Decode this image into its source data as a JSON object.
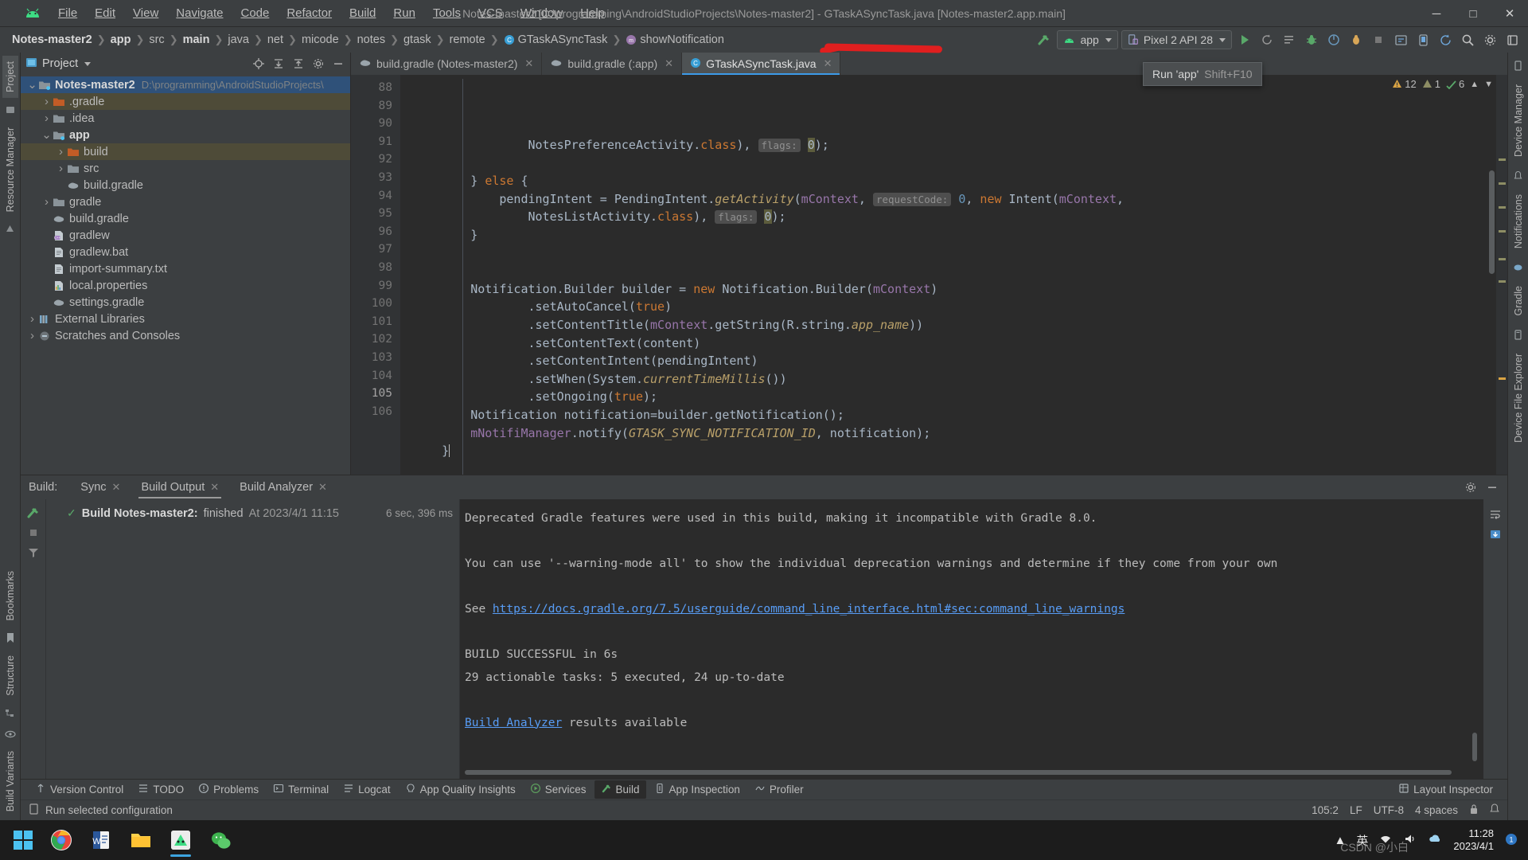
{
  "window": {
    "title": "Notes-master2 [D:\\programming\\AndroidStudioProjects\\Notes-master2] - GTaskASyncTask.java [Notes-master2.app.main]",
    "minimize": "─",
    "maximize": "□",
    "close": "✕"
  },
  "menubar": {
    "logo": "android-logo-icon",
    "items": [
      {
        "label": "File"
      },
      {
        "label": "Edit"
      },
      {
        "label": "View"
      },
      {
        "label": "Navigate"
      },
      {
        "label": "Code"
      },
      {
        "label": "Refactor"
      },
      {
        "label": "Build"
      },
      {
        "label": "Run"
      },
      {
        "label": "Tools"
      },
      {
        "label": "VCS"
      },
      {
        "label": "Window"
      },
      {
        "label": "Help"
      }
    ]
  },
  "breadcrumbs": [
    {
      "label": "Notes-master2",
      "bold": true
    },
    {
      "label": "app",
      "bold": true
    },
    {
      "label": "src",
      "bold": false
    },
    {
      "label": "main",
      "bold": true
    },
    {
      "label": "java",
      "bold": false
    },
    {
      "label": "net",
      "bold": false
    },
    {
      "label": "micode",
      "bold": false
    },
    {
      "label": "notes",
      "bold": false
    },
    {
      "label": "gtask",
      "bold": false
    },
    {
      "label": "remote",
      "bold": false
    },
    {
      "label": "GTaskASyncTask",
      "bold": false,
      "icon": "class-icon"
    },
    {
      "label": "showNotification",
      "bold": false,
      "icon": "method-icon"
    }
  ],
  "toolbar": {
    "build_label": "build-hammer-icon",
    "module_combo": "app",
    "device_combo": "Pixel 2 API 28",
    "run_button": "run-icon",
    "rerun_button": "rerun-icon",
    "coverage_button": "coverage-icon",
    "debug_button": "debug-icon",
    "profile_button": "profile-icon",
    "attach_button": "attach-debugger-icon",
    "devicemgr_button": "device-manager-icon",
    "stop_button": "stop-icon",
    "sdk_button": "sdk-manager-icon",
    "avd_button": "avd-manager-icon",
    "sync_button": "gradle-sync-icon",
    "search_button": "search-icon",
    "settings_button": "gear-icon",
    "more_button": "more-icon",
    "tooltip": {
      "text": "Run 'app'",
      "shortcut": "Shift+F10"
    }
  },
  "left_rail": {
    "top": [
      "Project",
      "Resource Manager"
    ],
    "bottom": [
      "Bookmarks",
      "Structure",
      "Build Variants"
    ]
  },
  "right_rail": {
    "items": [
      "Device Manager",
      "Notifications",
      "Gradle",
      "Device File Explorer"
    ]
  },
  "project_panel": {
    "title": "Project",
    "actions": [
      "locate-icon",
      "expand-all-icon",
      "collapse-all-icon",
      "gear-icon",
      "hide-icon"
    ],
    "tree": [
      {
        "depth": 0,
        "arrow": "down",
        "icon": "module-folder-icon",
        "label": "Notes-master2",
        "bold": true,
        "path": "D:\\programming\\AndroidStudioProjects\\",
        "state": "selected"
      },
      {
        "depth": 1,
        "arrow": "right",
        "icon": "folder-excluded-icon",
        "label": ".gradle",
        "bold": false,
        "state": "highlight"
      },
      {
        "depth": 1,
        "arrow": "right",
        "icon": "folder-icon",
        "label": ".idea",
        "bold": false,
        "state": "none"
      },
      {
        "depth": 1,
        "arrow": "down",
        "icon": "module-folder-icon",
        "label": "app",
        "bold": true,
        "state": "none"
      },
      {
        "depth": 2,
        "arrow": "right",
        "icon": "folder-excluded-icon",
        "label": "build",
        "bold": false,
        "state": "highlight"
      },
      {
        "depth": 2,
        "arrow": "right",
        "icon": "folder-icon",
        "label": "src",
        "bold": false,
        "state": "none"
      },
      {
        "depth": 2,
        "arrow": "none",
        "icon": "gradle-file-icon",
        "label": "build.gradle",
        "bold": false,
        "state": "none"
      },
      {
        "depth": 1,
        "arrow": "right",
        "icon": "folder-icon",
        "label": "gradle",
        "bold": false,
        "state": "none"
      },
      {
        "depth": 1,
        "arrow": "none",
        "icon": "gradle-file-icon",
        "label": "build.gradle",
        "bold": false,
        "state": "none"
      },
      {
        "depth": 1,
        "arrow": "none",
        "icon": "script-file-icon",
        "label": "gradlew",
        "bold": false,
        "state": "none"
      },
      {
        "depth": 1,
        "arrow": "none",
        "icon": "text-file-icon",
        "label": "gradlew.bat",
        "bold": false,
        "state": "none"
      },
      {
        "depth": 1,
        "arrow": "none",
        "icon": "text-file-icon",
        "label": "import-summary.txt",
        "bold": false,
        "state": "none"
      },
      {
        "depth": 1,
        "arrow": "none",
        "icon": "properties-file-icon",
        "label": "local.properties",
        "bold": false,
        "state": "none"
      },
      {
        "depth": 1,
        "arrow": "none",
        "icon": "gradle-file-icon",
        "label": "settings.gradle",
        "bold": false,
        "state": "none"
      },
      {
        "depth": 0,
        "arrow": "right",
        "icon": "libraries-icon",
        "label": "External Libraries",
        "bold": false,
        "state": "none"
      },
      {
        "depth": 0,
        "arrow": "right",
        "icon": "scratches-icon",
        "label": "Scratches and Consoles",
        "bold": false,
        "state": "none"
      }
    ]
  },
  "editor": {
    "tabs": [
      {
        "label": "build.gradle (Notes-master2)",
        "icon": "gradle-file-icon",
        "active": false
      },
      {
        "label": "build.gradle (:app)",
        "icon": "gradle-file-icon",
        "active": false
      },
      {
        "label": "GTaskASyncTask.java",
        "icon": "class-icon",
        "active": true
      }
    ],
    "inspections": {
      "warnings": "12",
      "weak_warnings": "1",
      "typos": "6"
    },
    "first_line": 88,
    "lines": [
      {
        "n": 88,
        "tokens": [
          {
            "t": "                ",
            "c": "plain"
          },
          {
            "t": "NotesPreferenceActivity.",
            "c": "plain"
          },
          {
            "t": "class",
            "c": "kw"
          },
          {
            "t": "), ",
            "c": "plain"
          },
          {
            "t": "flags:",
            "c": "hint"
          },
          {
            "t": " ",
            "c": "plain"
          },
          {
            "t": "0",
            "c": "numhl"
          },
          {
            "t": ");",
            "c": "plain"
          }
        ]
      },
      {
        "n": 89,
        "tokens": []
      },
      {
        "n": 90,
        "fold": "minus",
        "tokens": [
          {
            "t": "        } ",
            "c": "plain"
          },
          {
            "t": "else",
            "c": "kw"
          },
          {
            "t": " {",
            "c": "plain"
          }
        ]
      },
      {
        "n": 91,
        "tokens": [
          {
            "t": "            pendingIntent = PendingIntent.",
            "c": "plain"
          },
          {
            "t": "getActivity",
            "c": "stat"
          },
          {
            "t": "(",
            "c": "plain"
          },
          {
            "t": "mContext",
            "c": "fld"
          },
          {
            "t": ", ",
            "c": "plain"
          },
          {
            "t": "requestCode:",
            "c": "hint"
          },
          {
            "t": " ",
            "c": "plain"
          },
          {
            "t": "0",
            "c": "num"
          },
          {
            "t": ", ",
            "c": "plain"
          },
          {
            "t": "new",
            "c": "kw"
          },
          {
            "t": " Intent(",
            "c": "plain"
          },
          {
            "t": "mContext",
            "c": "fld"
          },
          {
            "t": ",",
            "c": "plain"
          }
        ]
      },
      {
        "n": 92,
        "tokens": [
          {
            "t": "                NotesListActivity.",
            "c": "plain"
          },
          {
            "t": "class",
            "c": "kw"
          },
          {
            "t": "), ",
            "c": "plain"
          },
          {
            "t": "flags:",
            "c": "hint"
          },
          {
            "t": " ",
            "c": "plain"
          },
          {
            "t": "0",
            "c": "numhl"
          },
          {
            "t": ");",
            "c": "plain"
          }
        ]
      },
      {
        "n": 93,
        "fold": "minus",
        "tokens": [
          {
            "t": "        }",
            "c": "plain"
          }
        ]
      },
      {
        "n": 94,
        "tokens": []
      },
      {
        "n": 95,
        "tokens": []
      },
      {
        "n": 96,
        "tokens": [
          {
            "t": "        Notification.Builder builder = ",
            "c": "plain"
          },
          {
            "t": "new",
            "c": "kw"
          },
          {
            "t": " Notification.Builder(",
            "c": "plain"
          },
          {
            "t": "mContext",
            "c": "fld"
          },
          {
            "t": ")",
            "c": "plain"
          }
        ]
      },
      {
        "n": 97,
        "tokens": [
          {
            "t": "                .setAutoCancel(",
            "c": "plain"
          },
          {
            "t": "true",
            "c": "kw"
          },
          {
            "t": ")",
            "c": "plain"
          }
        ]
      },
      {
        "n": 98,
        "tokens": [
          {
            "t": "                .setContentTitle(",
            "c": "plain"
          },
          {
            "t": "mContext",
            "c": "fld"
          },
          {
            "t": ".getString(R.string.",
            "c": "plain"
          },
          {
            "t": "app_name",
            "c": "stat"
          },
          {
            "t": "))",
            "c": "plain"
          }
        ]
      },
      {
        "n": 99,
        "tokens": [
          {
            "t": "                .setContentText(content)",
            "c": "plain"
          }
        ]
      },
      {
        "n": 100,
        "tokens": [
          {
            "t": "                .setContentIntent(pendingIntent)",
            "c": "plain"
          }
        ]
      },
      {
        "n": 101,
        "tokens": [
          {
            "t": "                .setWhen(System.",
            "c": "plain"
          },
          {
            "t": "currentTimeMillis",
            "c": "stat"
          },
          {
            "t": "())",
            "c": "plain"
          }
        ]
      },
      {
        "n": 102,
        "tokens": [
          {
            "t": "                .setOngoing(",
            "c": "plain"
          },
          {
            "t": "true",
            "c": "kw"
          },
          {
            "t": ");",
            "c": "plain"
          }
        ]
      },
      {
        "n": 103,
        "tokens": [
          {
            "t": "        Notification notification=builder.getNotification();",
            "c": "plain"
          }
        ]
      },
      {
        "n": 104,
        "tokens": [
          {
            "t": "        ",
            "c": "plain"
          },
          {
            "t": "mNotifiManager",
            "c": "fld"
          },
          {
            "t": ".notify(",
            "c": "plain"
          },
          {
            "t": "GTASK_SYNC_NOTIFICATION_ID",
            "c": "stat"
          },
          {
            "t": ", notification);",
            "c": "plain"
          }
        ]
      },
      {
        "n": 105,
        "fold": "minus",
        "caret": true,
        "tokens": [
          {
            "t": "    }",
            "c": "plain"
          }
        ]
      },
      {
        "n": 106,
        "tokens": []
      }
    ]
  },
  "build_panel": {
    "label": "Build:",
    "tabs": [
      {
        "label": "Sync",
        "closable": true,
        "active": false
      },
      {
        "label": "Build Output",
        "closable": true,
        "active": true
      },
      {
        "label": "Build Analyzer",
        "closable": true,
        "active": false
      }
    ],
    "actions": [
      "gear-icon",
      "hide-icon"
    ],
    "tool_buttons": [
      "restart-icon",
      "stop-icon",
      "filter-icon"
    ],
    "tree": {
      "status_icon": "check-icon",
      "title": "Build Notes-master2:",
      "status": "finished",
      "timestamp": "At 2023/4/1 11:15",
      "duration": "6 sec, 396 ms"
    },
    "console": [
      {
        "text": "Deprecated Gradle features were used in this build, making it incompatible with Gradle 8.0.",
        "link": false
      },
      {
        "text": "",
        "link": false
      },
      {
        "text": "You can use '--warning-mode all' to show the individual deprecation warnings and determine if they come from your own",
        "link": false
      },
      {
        "text": "",
        "link": false
      },
      {
        "text": "See ",
        "link": false,
        "linkText": "https://docs.gradle.org/7.5/userguide/command_line_interface.html#sec:command_line_warnings"
      },
      {
        "text": "",
        "link": false
      },
      {
        "text": "BUILD SUCCESSFUL in 6s",
        "link": false
      },
      {
        "text": "29 actionable tasks: 5 executed, 24 up-to-date",
        "link": false
      },
      {
        "text": "",
        "link": false
      },
      {
        "text": "",
        "link": false,
        "linkText2": "Build Analyzer",
        "after": " results available"
      }
    ],
    "console_right_buttons": [
      "wrap-icon",
      "scroll-to-end-icon"
    ]
  },
  "toolwindow_bar": {
    "items": [
      {
        "label": "Version Control",
        "icon": "vcs-icon",
        "active": false
      },
      {
        "label": "TODO",
        "icon": "todo-icon",
        "active": false
      },
      {
        "label": "Problems",
        "icon": "problems-icon",
        "active": false
      },
      {
        "label": "Terminal",
        "icon": "terminal-icon",
        "active": false
      },
      {
        "label": "Logcat",
        "icon": "logcat-icon",
        "active": false
      },
      {
        "label": "App Quality Insights",
        "icon": "insights-icon",
        "active": false
      },
      {
        "label": "Services",
        "icon": "services-icon",
        "active": false
      },
      {
        "label": "Build",
        "icon": "build-icon",
        "active": true
      },
      {
        "label": "App Inspection",
        "icon": "inspection-icon",
        "active": false
      },
      {
        "label": "Profiler",
        "icon": "profiler-icon",
        "active": false
      }
    ],
    "right": [
      {
        "label": "Layout Inspector",
        "icon": "layout-inspector-icon"
      }
    ]
  },
  "statusbar": {
    "message": "Run selected configuration",
    "icon": "run-config-icon",
    "caret_position": "105:2",
    "line_separator": "LF",
    "encoding": "UTF-8",
    "indent": "4 spaces",
    "lock_icon": "lock-icon",
    "notification_icon": "notifications-icon"
  },
  "taskbar": {
    "start": "windows-start-icon",
    "apps": [
      {
        "name": "chrome-icon",
        "active": false
      },
      {
        "name": "word-icon",
        "active": false
      },
      {
        "name": "explorer-icon",
        "active": false
      },
      {
        "name": "android-studio-icon",
        "active": true
      },
      {
        "name": "wechat-icon",
        "active": false
      }
    ],
    "tray": {
      "chevron": "⌃",
      "ime": "英",
      "wifi": "wifi-icon",
      "volume": "volume-icon",
      "cloud": "cloud-icon"
    },
    "clock": {
      "time": "11:28",
      "date": "2023/4/1"
    },
    "watermark": "CSDN @小白"
  },
  "colors": {
    "accent": "#3c9ae8",
    "annotation_red": "#e01f1f",
    "success_green": "#59a869",
    "editor_bg": "#2b2b2b",
    "panel_bg": "#3c3f41",
    "link_blue": "#589df6"
  }
}
